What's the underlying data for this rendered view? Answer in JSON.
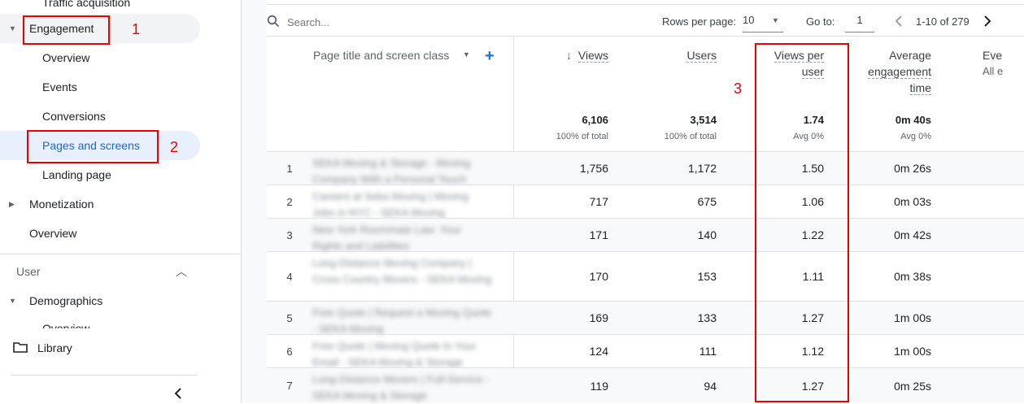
{
  "sidebar": {
    "partial_top": "Traffic acquisition",
    "engagement": "Engagement",
    "items": [
      "Overview",
      "Events",
      "Conversions",
      "Pages and screens",
      "Landing page"
    ],
    "monetization": "Monetization",
    "monetization_overview": "Overview",
    "user_section": "User",
    "demographics": "Demographics",
    "demographics_partial": "Overview",
    "library": "Library"
  },
  "annotations": [
    "1",
    "2",
    "3"
  ],
  "toolbar": {
    "search_placeholder": "Search...",
    "rows_per_page_label": "Rows per page:",
    "rows_per_page_value": "10",
    "goto_label": "Go to:",
    "goto_value": "1",
    "range": "1-10 of 279"
  },
  "table": {
    "dimension_header": "Page title and screen class",
    "headers": {
      "views": "Views",
      "users": "Users",
      "views_per_user": [
        "Views per",
        "user"
      ],
      "avg_engagement": [
        "Average",
        "engagement",
        "time"
      ],
      "events": [
        "Eve",
        "All e"
      ]
    },
    "totals": {
      "views": "6,106",
      "views_sub": "100% of total",
      "users": "3,514",
      "users_sub": "100% of total",
      "vpu": "1.74",
      "vpu_sub": "Avg 0%",
      "aet": "0m 40s",
      "aet_sub": "Avg 0%"
    },
    "rows": [
      {
        "idx": "1",
        "title": "SEKA Moving & Storage - Moving Company With a Personal Touch",
        "views": "1,756",
        "users": "1,172",
        "vpu": "1.50",
        "aet": "0m 26s"
      },
      {
        "idx": "2",
        "title": "Careers at Seka Moving | Moving Jobs in NYC - SEKA Moving",
        "views": "717",
        "users": "675",
        "vpu": "1.06",
        "aet": "0m 03s"
      },
      {
        "idx": "3",
        "title": "New York Roommate Law: Your Rights and Liabilities",
        "views": "171",
        "users": "140",
        "vpu": "1.22",
        "aet": "0m 42s"
      },
      {
        "idx": "4",
        "title": "Long-Distance Moving Company | Cross Country Movers - SEKA Moving",
        "views": "170",
        "users": "153",
        "vpu": "1.11",
        "aet": "0m 38s"
      },
      {
        "idx": "5",
        "title": "Free Quote | Request a Moving Quote - SEKA Moving",
        "views": "169",
        "users": "133",
        "vpu": "1.27",
        "aet": "1m 00s"
      },
      {
        "idx": "6",
        "title": "Free Quote | Moving Quote In Your Email - SEKA Moving & Storage",
        "views": "124",
        "users": "111",
        "vpu": "1.12",
        "aet": "1m 00s"
      },
      {
        "idx": "7",
        "title": "Long-Distance Movers | Full-Service - SEKA Moving & Storage",
        "views": "119",
        "users": "94",
        "vpu": "1.27",
        "aet": "0m 25s"
      }
    ]
  },
  "colors": {
    "active_blue": "#1967d2",
    "annotation_red": "#ee0000"
  }
}
